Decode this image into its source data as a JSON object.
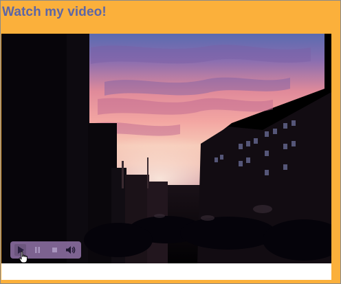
{
  "page": {
    "title": "Watch my video!",
    "background_color": "#fbb03b",
    "title_color": "#5d66a6"
  },
  "video": {
    "content": "sunset-city-street-scene"
  },
  "controls": {
    "buttons": [
      {
        "icon": "play-icon",
        "state": "active"
      },
      {
        "icon": "pause-icon",
        "state": "disabled"
      },
      {
        "icon": "stop-icon",
        "state": "disabled"
      },
      {
        "icon": "volume-icon",
        "state": "active"
      }
    ],
    "bar_color": "#9678af"
  },
  "pointer": {
    "icon": "hand-pointer-icon"
  }
}
